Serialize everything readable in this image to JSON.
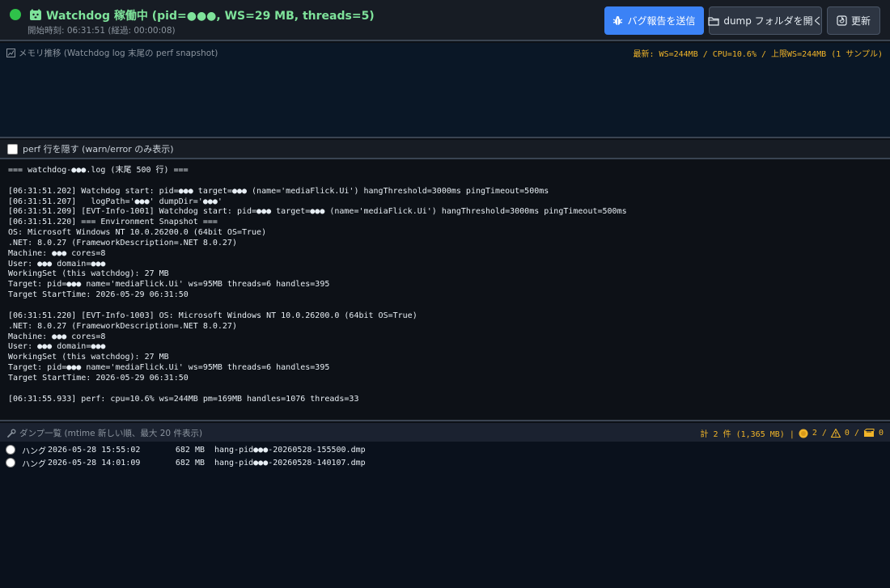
{
  "header": {
    "title": "Watchdog 稼働中 (pid=●●●, WS=29 MB, threads=5)",
    "subtitle": "開始時刻: 06:31:51 (経過: 00:00:08)",
    "buttons": {
      "report": "バグ報告を送信",
      "dump_folder": "dump フォルダを開く",
      "refresh": "更新"
    },
    "status_color": "#2fc24a",
    "accent_color": "#3b82f6"
  },
  "perf": {
    "title": "メモリ推移 (Watchdog log 末尾の perf snapshot)",
    "stats": "最新: WS=244MB / CPU=10.6% / 上限WS=244MB (1 サンプル)"
  },
  "filter": {
    "label": "perf 行を隠す (warn/error のみ表示)",
    "checked": false
  },
  "log": {
    "lines": [
      "=== watchdog-●●●.log (末尾 500 行) ===",
      "",
      "[06:31:51.202] Watchdog start: pid=●●● target=●●● (name='mediaFlick.Ui') hangThreshold=3000ms pingTimeout=500ms",
      "[06:31:51.207]   logPath='●●●' dumpDir='●●●'",
      "[06:31:51.209] [EVT-Info-1001] Watchdog start: pid=●●● target=●●● (name='mediaFlick.Ui') hangThreshold=3000ms pingTimeout=500ms",
      "[06:31:51.220] === Environment Snapshot ===",
      "OS: Microsoft Windows NT 10.0.26200.0 (64bit OS=True)",
      ".NET: 8.0.27 (FrameworkDescription=.NET 8.0.27)",
      "Machine: ●●● cores=8",
      "User: ●●● domain=●●●",
      "WorkingSet (this watchdog): 27 MB",
      "Target: pid=●●● name='mediaFlick.Ui' ws=95MB threads=6 handles=395",
      "Target StartTime: 2026-05-29 06:31:50",
      "",
      "[06:31:51.220] [EVT-Info-1003] OS: Microsoft Windows NT 10.0.26200.0 (64bit OS=True)",
      ".NET: 8.0.27 (FrameworkDescription=.NET 8.0.27)",
      "Machine: ●●● cores=8",
      "User: ●●● domain=●●●",
      "WorkingSet (this watchdog): 27 MB",
      "Target: pid=●●● name='mediaFlick.Ui' ws=95MB threads=6 handles=395",
      "Target StartTime: 2026-05-29 06:31:50",
      "",
      "[06:31:55.933] perf: cpu=10.6% ws=244MB pm=169MB handles=1076 threads=33"
    ]
  },
  "dumps": {
    "title": "ダンプ一覧 (mtime 新しい順、最大 20 件表示)",
    "summary": "計 2 件 (1,365 MB) |",
    "hang_count": "2 /",
    "warn_count": "0 /",
    "other_count": "0",
    "items": [
      {
        "type": "ハング",
        "time": "2026-05-28 15:55:02",
        "size": "682 MB",
        "file": "hang-pid●●●-20260528-155500.dmp"
      },
      {
        "type": "ハング",
        "time": "2026-05-28 14:01:09",
        "size": "682 MB",
        "file": "hang-pid●●●-20260528-140107.dmp"
      }
    ]
  }
}
